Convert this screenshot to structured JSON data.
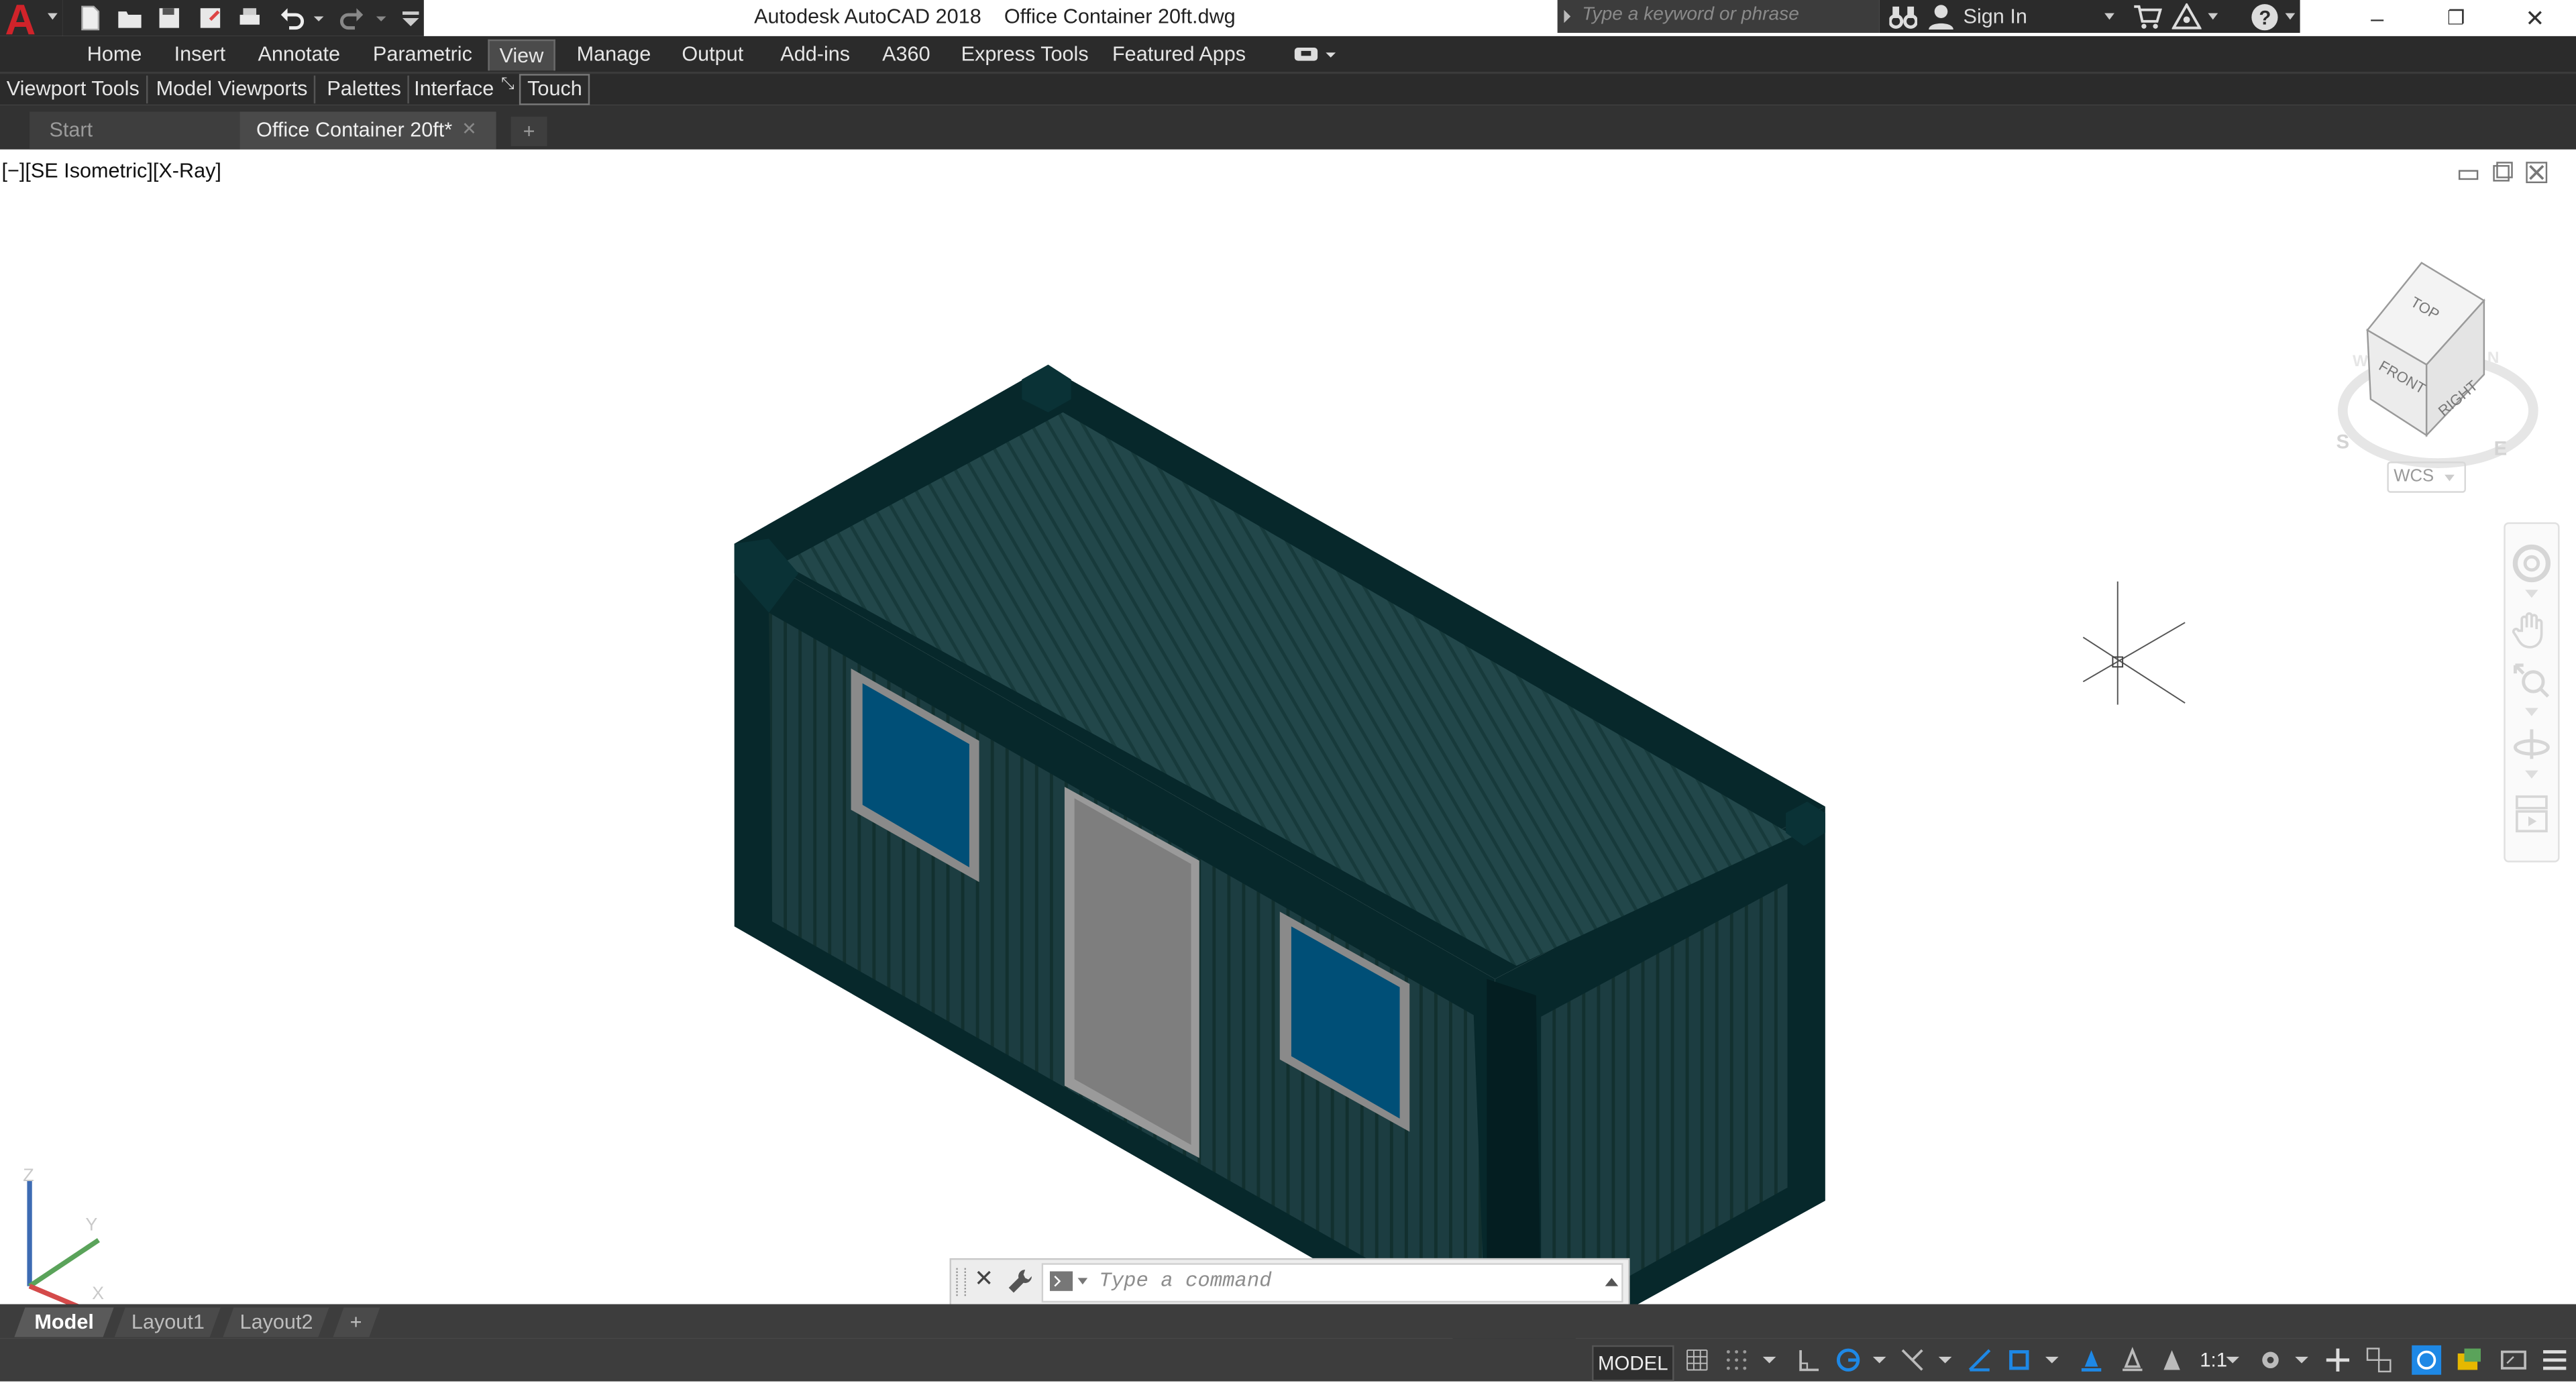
{
  "window": {
    "app_title": "Autodesk AutoCAD 2018",
    "doc_title": "Office Container 20ft.dwg",
    "minimize": "–",
    "restore": "❐",
    "close": "✕"
  },
  "search": {
    "placeholder": "Type a keyword or phrase"
  },
  "infocenter": {
    "sign_in": "Sign In"
  },
  "ribbon_tabs": [
    "Home",
    "Insert",
    "Annotate",
    "Parametric",
    "View",
    "Manage",
    "Output",
    "Add-ins",
    "A360",
    "Express Tools",
    "Featured Apps"
  ],
  "active_ribbon_tab": "View",
  "ribbon_panels": [
    "Viewport Tools",
    "Model Viewports",
    "Palettes",
    "Interface",
    "Touch"
  ],
  "file_tabs": {
    "start": "Start",
    "active": "Office Container 20ft*",
    "new_tab": "+"
  },
  "viewport": {
    "label": "[−][SE Isometric][X-Ray]",
    "viewcube": {
      "top": "TOP",
      "front": "FRONT",
      "right": "RIGHT",
      "compass_s": "S",
      "compass_e": "E",
      "compass_w": "W",
      "compass_n": "N"
    },
    "wcs_label": "WCS",
    "ucs": {
      "z": "Z",
      "y": "Y",
      "x": "X"
    }
  },
  "command_line": {
    "placeholder": "Type a command"
  },
  "layout_tabs": [
    "Model",
    "Layout1",
    "Layout2"
  ],
  "active_layout": "Model",
  "status_bar": {
    "model_label": "MODEL",
    "scale": "1:1"
  },
  "colors": {
    "container_dark": "#07282b",
    "container_side": "#1b3c40",
    "roof": "#1e4244",
    "window_glass": "#004f77",
    "door": "#7e7e7e",
    "accent_blue": "#1e88e5"
  }
}
